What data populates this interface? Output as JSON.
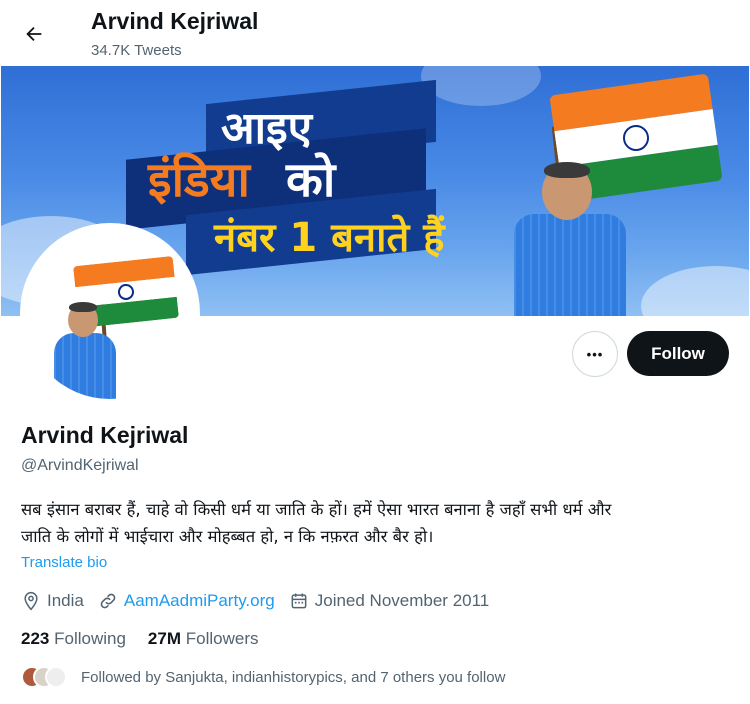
{
  "header": {
    "title": "Arvind Kejriwal",
    "tweet_count": "34.7K Tweets",
    "back_icon": "arrow-left-icon"
  },
  "banner": {
    "headline_line1": "आइए",
    "headline_line2a": "इंडिया",
    "headline_line2b": "को",
    "headline_line3": "नंबर 1 बनाते हैं",
    "colors": {
      "sky": "#4a8be6",
      "band": "#123c8f",
      "saffron": "#f47b20",
      "yellow": "#ffd21f",
      "green": "#1e8a3b"
    }
  },
  "actions": {
    "more_label": "•••",
    "follow_label": "Follow"
  },
  "profile": {
    "name": "Arvind Kejriwal",
    "handle": "@ArvindKejriwal",
    "bio_line1": "सब इंसान बराबर हैं, चाहे वो किसी धर्म या जाति के हों। हमें ऐसा भारत बनाना है जहाँ सभी धर्म और",
    "bio_line2": "जाति के लोगों में भाईचारा और मोहब्बत हो, न कि नफ़रत और बैर हो।",
    "translate_label": "Translate bio",
    "location": "India",
    "website": "AamAadmiParty.org",
    "joined": "Joined November 2011",
    "icons": {
      "location": "location-pin-icon",
      "link": "link-icon",
      "calendar": "calendar-icon"
    }
  },
  "stats": {
    "following_count": "223",
    "following_label": "Following",
    "followers_count": "27M",
    "followers_label": "Followers"
  },
  "followed_by": {
    "text": "Followed by Sanjukta, indianhistorypics, and 7 others you follow"
  },
  "colors": {
    "text_primary": "#0f1419",
    "text_secondary": "#536471",
    "link": "#1d9bf0",
    "follow_bg": "#0f1419"
  }
}
